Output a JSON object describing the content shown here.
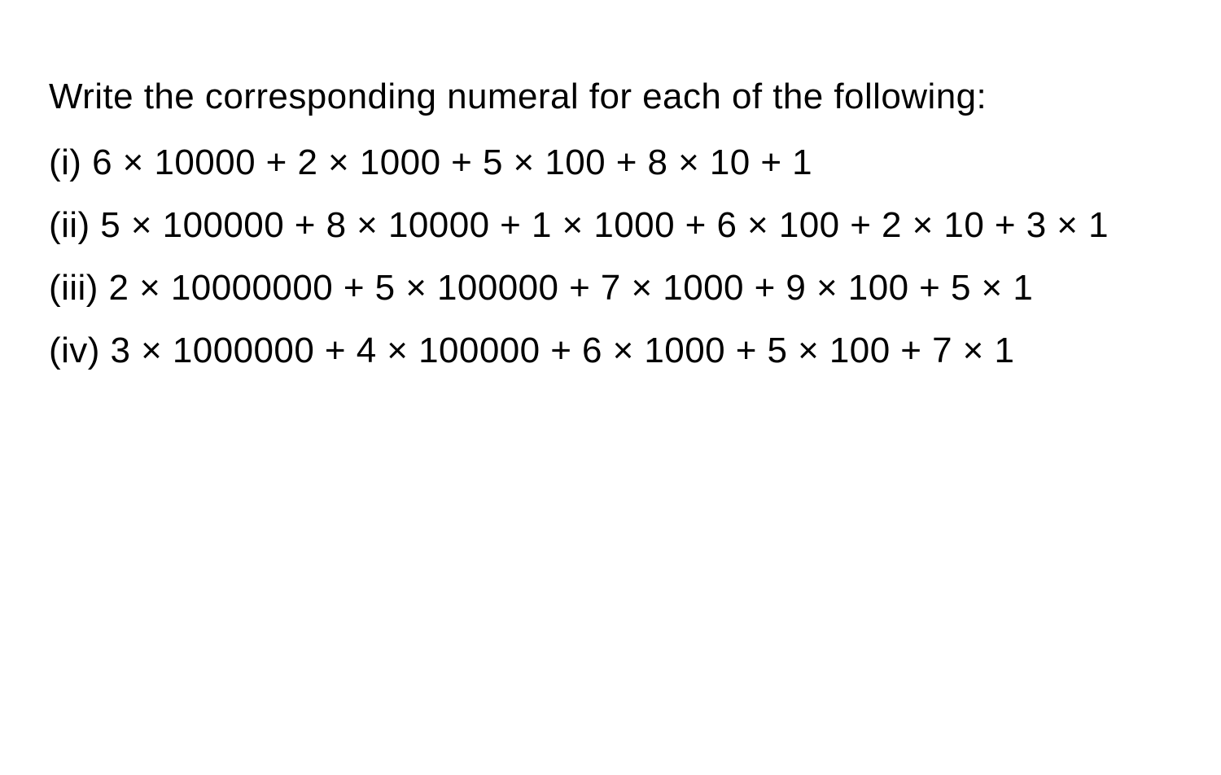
{
  "intro": "Write the corresponding numeral for each of the following:",
  "items": [
    "(i) 6 × 10000 + 2 × 1000 + 5 × 100 + 8 × 10 + 1",
    "(ii) 5 × 100000 + 8 × 10000 + 1 × 1000 + 6 × 100 + 2 × 10 + 3 × 1",
    "(iii) 2 × 10000000 + 5 × 100000 + 7 × 1000 + 9 × 100 + 5 × 1",
    "(iv) 3 × 1000000 + 4 × 100000 + 6 × 1000 + 5 × 100 + 7 × 1"
  ]
}
